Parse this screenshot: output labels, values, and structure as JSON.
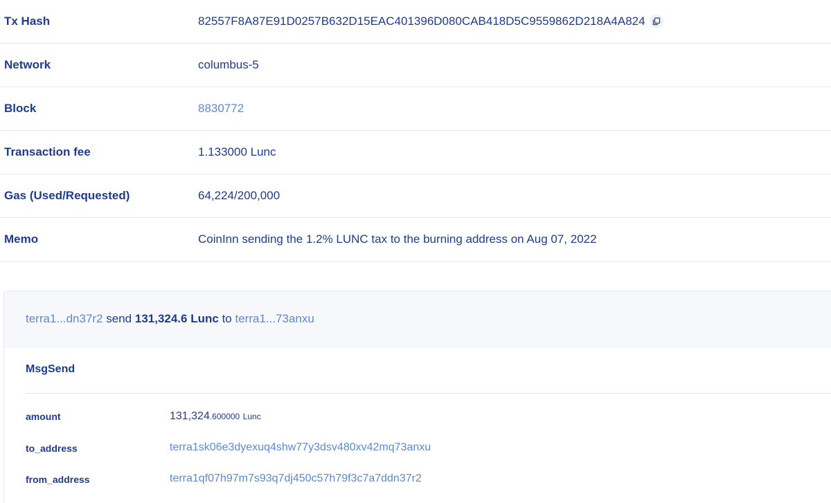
{
  "tx_details": {
    "tx_hash": {
      "label": "Tx Hash",
      "value": "82557F8A87E91D0257B632D15EAC401396D080CAB418D5C9559862D218A4A824"
    },
    "network": {
      "label": "Network",
      "value": "columbus-5"
    },
    "block": {
      "label": "Block",
      "value": "8830772"
    },
    "fee": {
      "label": "Transaction fee",
      "value": "1.133000 Lunc"
    },
    "gas": {
      "label": "Gas (Used/Requested)",
      "value": "64,224/200,000"
    },
    "memo": {
      "label": "Memo",
      "value": "CoinInn sending the 1.2% LUNC tax to the burning address on Aug 07, 2022"
    }
  },
  "message": {
    "summary": {
      "from": "terra1...dn37r2",
      "verb": "send",
      "amount": "131,324.6 Lunc",
      "preposition": "to",
      "to": "terra1...73anxu"
    },
    "type": "MsgSend",
    "fields": {
      "amount": {
        "label": "amount",
        "integer": "131,324",
        "decimal": ".600000",
        "unit": "Lunc"
      },
      "to_address": {
        "label": "to_address",
        "value": "terra1sk06e3dyexuq4shw77y3dsv480xv42mq73anxu"
      },
      "from_address": {
        "label": "from_address",
        "value": "terra1qf07h97m7s93q7dj450c57h79f3c7a7ddn37r2"
      }
    }
  },
  "colors": {
    "label_text": "#1f3c8c",
    "link_text": "#5a89d3",
    "summary_background": "#f6f8fc",
    "row_border": "#e4e8f0"
  },
  "icons": {
    "copy": "copy-icon"
  }
}
